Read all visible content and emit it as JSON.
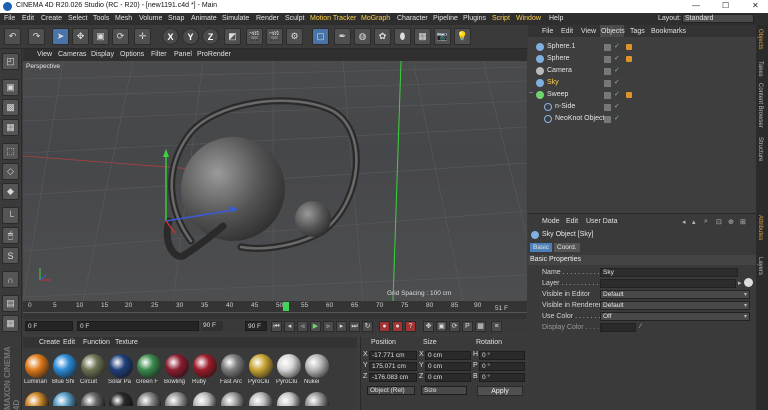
{
  "titlebar": {
    "title": "CINEMA 4D R20.026 Studio (RC - R20) - [new1191.c4d *] - Main",
    "min": "—",
    "max": "☐",
    "close": "✕"
  },
  "menu": [
    {
      "label": "File"
    },
    {
      "label": "Edit"
    },
    {
      "label": "Create"
    },
    {
      "label": "Select"
    },
    {
      "label": "Tools"
    },
    {
      "label": "Mesh"
    },
    {
      "label": "Volume"
    },
    {
      "label": "Snap"
    },
    {
      "label": "Animate"
    },
    {
      "label": "Simulate"
    },
    {
      "label": "Render"
    },
    {
      "label": "Sculpt"
    },
    {
      "label": "Motion Tracker",
      "hl": true
    },
    {
      "label": "MoGraph",
      "hl": true
    },
    {
      "label": "Character"
    },
    {
      "label": "Pipeline"
    },
    {
      "label": "Plugins"
    },
    {
      "label": "Script",
      "hl": true
    },
    {
      "label": "Window",
      "hl": true
    },
    {
      "label": "Help"
    }
  ],
  "layout": {
    "label": "Layout:",
    "value": "Standard"
  },
  "toolbar": {
    "axes": [
      "X",
      "Y",
      "Z"
    ]
  },
  "viewport": {
    "menu": [
      "View",
      "Cameras",
      "Display",
      "Options",
      "Filter",
      "Panel",
      "ProRender"
    ],
    "label": "Perspective",
    "grid_spacing": "Grid Spacing : 100 cm"
  },
  "timeline": {
    "ticks": [
      "0",
      "5",
      "10",
      "15",
      "20",
      "25",
      "30",
      "35",
      "40",
      "45",
      "50",
      "55",
      "60",
      "65",
      "70",
      "75",
      "80",
      "85",
      "90"
    ],
    "current": "51",
    "end_label": "51 F"
  },
  "playbar": {
    "start": "0 F",
    "start2": "0 F",
    "end": "90 F",
    "end2": "90 F"
  },
  "materials": {
    "menu": [
      "Create",
      "Edit",
      "Function",
      "Texture"
    ],
    "items": [
      {
        "name": "Luminan",
        "color": "#e07a1a"
      },
      {
        "name": "Blue Shi",
        "color": "#2a8ad6"
      },
      {
        "name": "Circuit",
        "color": "#6d7352"
      },
      {
        "name": "Solar Pa",
        "color": "#1f3f7a"
      },
      {
        "name": "Green F",
        "color": "#3b8a4e"
      },
      {
        "name": "Bowling",
        "color": "#8a1d2f"
      },
      {
        "name": "Ruby",
        "color": "#9d1b2a"
      },
      {
        "name": "Fast Arc",
        "color": "#7d7d7d"
      },
      {
        "name": "PyroClu",
        "color": "#c9a534"
      },
      {
        "name": "PyroClu",
        "color": "#d7d7d7"
      },
      {
        "name": "Nukei",
        "color": "#b8b8b8"
      }
    ],
    "row2": [
      "#d08a2c",
      "#5aa0c8",
      "#6a6a6a",
      "#2a2a2a",
      "#888888",
      "#9a9a9a",
      "#c0c0c0",
      "#a0a0a0",
      "#bdbdbd",
      "#c8c8c8",
      "#9e9e9e"
    ]
  },
  "coords": {
    "headers": [
      "Position",
      "Size",
      "Rotation"
    ],
    "rows": [
      {
        "axis": "X",
        "pos": "-17.771 cm",
        "size": "0 cm",
        "rot_axis": "H",
        "rot": "0 °"
      },
      {
        "axis": "Y",
        "pos": "175.071 cm",
        "size": "0 cm",
        "rot_axis": "P",
        "rot": "0 °"
      },
      {
        "axis": "Z",
        "pos": "-176.083 cm",
        "size": "0 cm",
        "rot_axis": "B",
        "rot": "0 °"
      }
    ],
    "mode": "Object (Rel)",
    "size_mode": "Size",
    "apply": "Apply"
  },
  "objects": {
    "menu": [
      "File",
      "Edit",
      "View",
      "Objects",
      "Tags",
      "Bookmarks"
    ],
    "rows": [
      {
        "name": "Sphere.1",
        "color": "#7fb0e0",
        "tag": true
      },
      {
        "name": "Sphere",
        "color": "#7fb0e0",
        "tag": true
      },
      {
        "name": "Camera",
        "color": "#bbbbbb",
        "tag": false
      },
      {
        "name": "Sky",
        "color": "#7fb0e0",
        "tag": false
      },
      {
        "name": "Sweep",
        "color": "#6fd46f",
        "tag": true
      },
      {
        "name": "n-Side",
        "color": "#8ab4e8",
        "tag": false
      },
      {
        "name": "NeoKnot Object",
        "color": "#8ab4e8",
        "tag": false
      }
    ]
  },
  "sidetabs": [
    "Objects",
    "Takes",
    "Content Browser",
    "Structure",
    "Attributes",
    "Layers"
  ],
  "attributes": {
    "menu": [
      "Mode",
      "Edit",
      "User Data"
    ],
    "title": "Sky Object [Sky]",
    "tabs": [
      "Basic",
      "Coord."
    ],
    "section": "Basic Properties",
    "props": [
      {
        "label": "Name . . . . . . . . . . .",
        "value": "Sky"
      },
      {
        "label": "Layer . . . . . . . . . . .",
        "value": ""
      },
      {
        "label": "Visible in Editor",
        "value": "Default"
      },
      {
        "label": "Visible in Renderer",
        "value": "Default"
      },
      {
        "label": "Use Color . . . . . . .",
        "value": "Off"
      },
      {
        "label": "Display Color . . . .",
        "value": ""
      }
    ]
  }
}
